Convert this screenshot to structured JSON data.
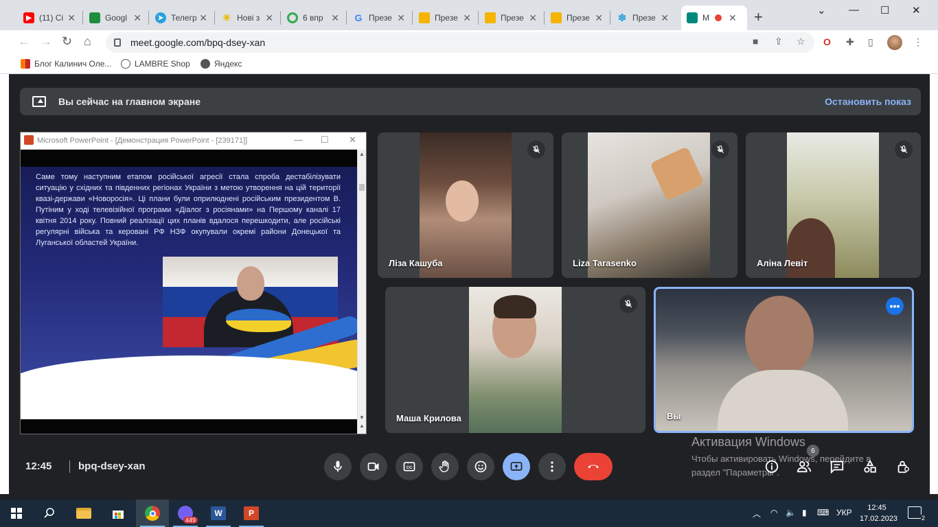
{
  "browser": {
    "tabs": [
      {
        "title": "(11) Ci",
        "icon": "youtube-icon",
        "color": "#ff0000"
      },
      {
        "title": "Googl",
        "icon": "google-classroom-icon",
        "color": "#1e8e3e"
      },
      {
        "title": "Телегр",
        "icon": "telegram-icon",
        "color": "#2aa1da"
      },
      {
        "title": "Нові з",
        "icon": "sun-icon",
        "color": "#f2b600"
      },
      {
        "title": "6 впр",
        "icon": "circle-icon",
        "color": "#34a853"
      },
      {
        "title": "Презе",
        "icon": "google-icon",
        "color": "#4285f4"
      },
      {
        "title": "Презе",
        "icon": "slides-icon",
        "color": "#f4b400"
      },
      {
        "title": "Презе",
        "icon": "slides-icon",
        "color": "#f4b400"
      },
      {
        "title": "Презе",
        "icon": "slides-icon",
        "color": "#f4b400"
      },
      {
        "title": "Презе",
        "icon": "snowflake-icon",
        "color": "#2aa1da"
      },
      {
        "title": "M",
        "icon": "meet-icon",
        "color": "#00897b"
      }
    ],
    "url": "meet.google.com/bpq-dsey-xan",
    "bookmarks": [
      {
        "label": "Блог Калинич Оле...",
        "icon": "blog-icon"
      },
      {
        "label": "LAMBRE Shop",
        "icon": "lambre-icon"
      },
      {
        "label": "Яндекс",
        "icon": "globe-icon"
      }
    ]
  },
  "meet": {
    "banner_text": "Вы сейчас на главном экране",
    "stop_label": "Остановить показ",
    "time": "12:45",
    "code": "bpq-dsey-xan",
    "participants_count": "6",
    "participants": [
      {
        "name": "Ліза Кашуба",
        "muted": true
      },
      {
        "name": "Liza Tarasenko",
        "muted": true
      },
      {
        "name": "Аліна Левіт",
        "muted": true
      },
      {
        "name": "Маша Крилова",
        "muted": true
      },
      {
        "name": "Вы",
        "muted": false
      }
    ]
  },
  "powerpoint": {
    "window_title": "Microsoft PowerPoint - [Демонстрация PowerPoint - [239171]]",
    "slide_text": "Саме тому наступним етапом російської агресії стала спроба дестабілізувати ситуацію у східних та південних регіонах України з метою утворення на цій території квазі-держави «Новоросія». Ці плани були оприлюднені російським президентом В. Путіним у ході телевізійної програми «Діалог з росіянами» на Першому каналі 17 квітня 2014 року. Повний реалізації цих планів вдалося перешкодити, але російські регулярні війська та керовані РФ НЗФ окупували окремі райони Донецької та Луганської областей України."
  },
  "activation": {
    "title": "Активация Windows",
    "line1": "Чтобы активировать Windows, перейдите в",
    "line2": "раздел \"Параметры\"."
  },
  "taskbar": {
    "viber_badge": "449",
    "language": "УКР",
    "time": "12:45",
    "date": "17.02.2023",
    "notifications": "2"
  }
}
